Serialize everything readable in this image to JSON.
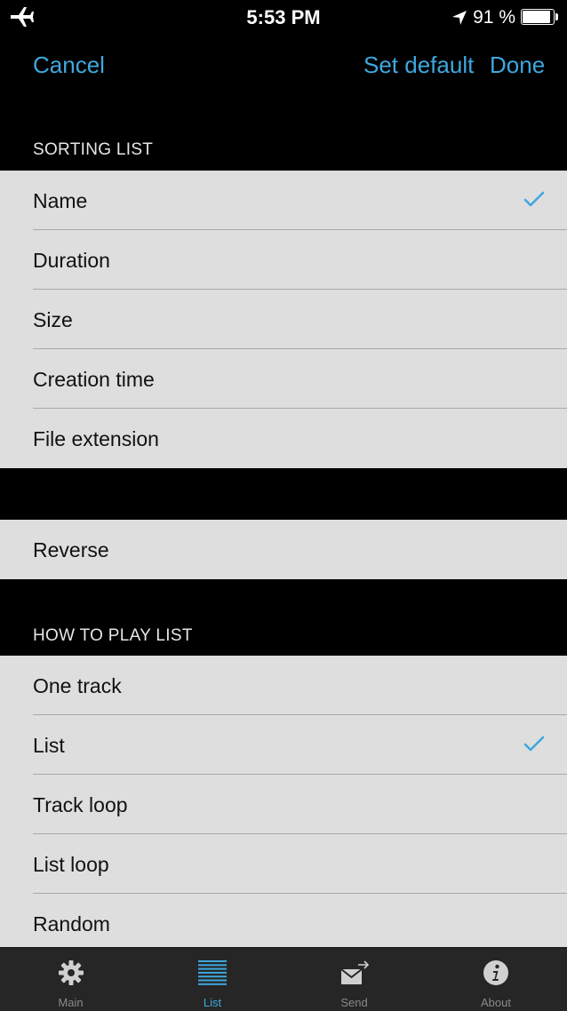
{
  "status_bar": {
    "time": "5:53 PM",
    "battery_text": "91 %",
    "battery_level": 0.91,
    "icons": [
      "airplane-icon",
      "location-arrow-icon",
      "battery-icon"
    ]
  },
  "nav": {
    "cancel": "Cancel",
    "set_default": "Set default",
    "done": "Done",
    "accent_color": "#3ea8df"
  },
  "sorting": {
    "header": "SORTING LIST",
    "items": [
      {
        "label": "Name",
        "checked": true
      },
      {
        "label": "Duration",
        "checked": false
      },
      {
        "label": "Size",
        "checked": false
      },
      {
        "label": "Creation time",
        "checked": false
      },
      {
        "label": "File extension",
        "checked": false
      }
    ]
  },
  "reverse": {
    "label": "Reverse"
  },
  "play": {
    "header": "HOW TO PLAY LIST",
    "items": [
      {
        "label": "One track",
        "checked": false
      },
      {
        "label": "List",
        "checked": true
      },
      {
        "label": "Track loop",
        "checked": false
      },
      {
        "label": "List loop",
        "checked": false
      },
      {
        "label": "Random",
        "checked": false
      }
    ]
  },
  "tabs": [
    {
      "label": "Main",
      "icon": "gear-icon",
      "active": false
    },
    {
      "label": "List",
      "icon": "list-icon",
      "active": true
    },
    {
      "label": "Send",
      "icon": "send-mail-icon",
      "active": false
    },
    {
      "label": "About",
      "icon": "info-icon",
      "active": false
    }
  ]
}
